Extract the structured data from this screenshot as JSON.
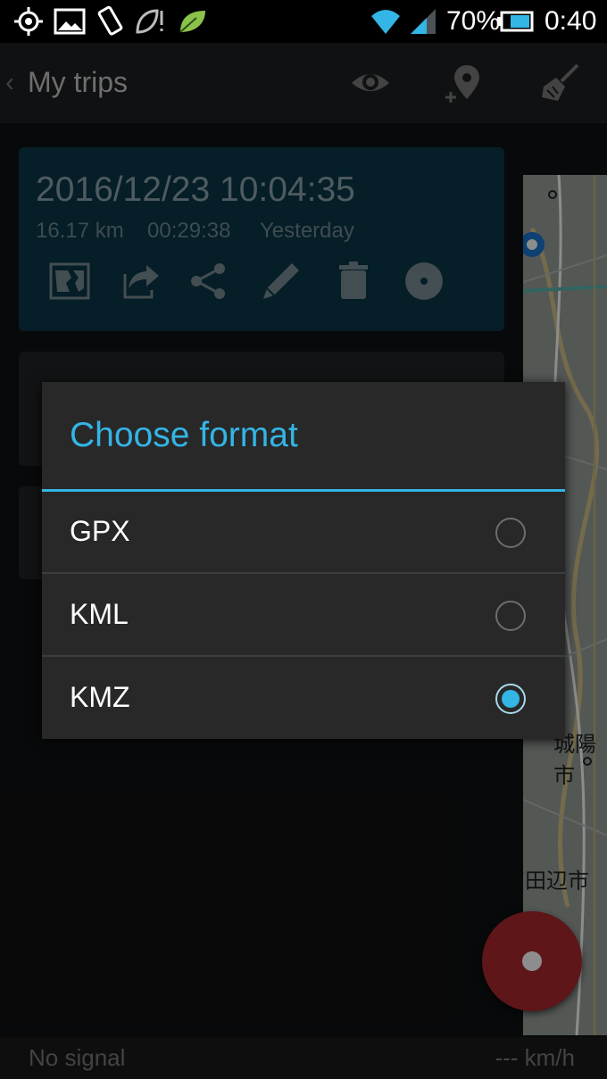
{
  "status_bar": {
    "battery": "70%",
    "time": "0:40",
    "icons": [
      "gps-icon",
      "image-icon",
      "screen-rotate-icon",
      "leaf-alert-icon",
      "leaf-icon",
      "wifi-icon",
      "signal-icon",
      "battery-icon"
    ]
  },
  "action_bar": {
    "back_glyph": "‹",
    "title": "My trips",
    "actions": [
      "eye-icon",
      "add-location-icon",
      "broom-icon"
    ]
  },
  "trip_card": {
    "datetime": "2016/12/23 10:04:35",
    "distance": "16.17 km",
    "duration": "00:29:38",
    "when": "Yesterday",
    "actions": [
      "map-icon",
      "export-icon",
      "share-icon",
      "edit-icon",
      "delete-icon",
      "record-icon"
    ]
  },
  "map": {
    "labels": [
      "城陽市",
      "京田辺市"
    ]
  },
  "dialog": {
    "title": "Choose format",
    "options": [
      {
        "label": "GPX",
        "selected": false
      },
      {
        "label": "KML",
        "selected": false
      },
      {
        "label": "KMZ",
        "selected": true
      }
    ],
    "accent_color": "#33b5e5"
  },
  "bottom_bar": {
    "signal": "No signal",
    "speed": "--- km/h"
  }
}
